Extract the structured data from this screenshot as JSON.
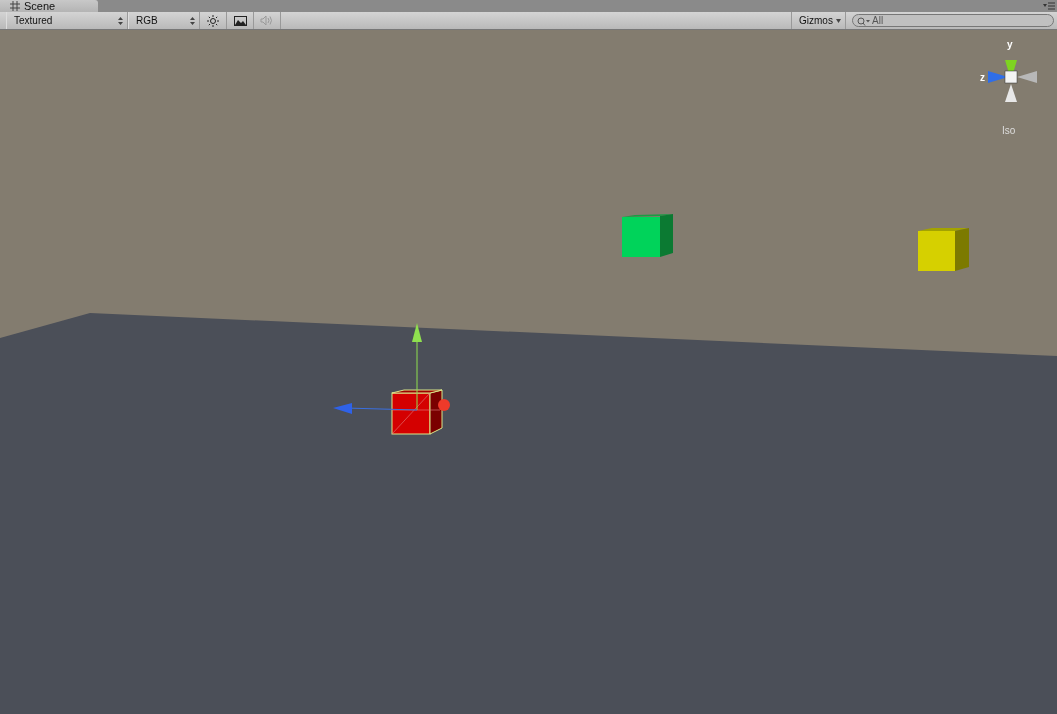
{
  "tab": {
    "label": "Scene"
  },
  "toolbar": {
    "draw_mode": "Textured",
    "render_mode": "RGB",
    "toggles": [
      {
        "kind": "lighting",
        "disabled": false
      },
      {
        "kind": "image",
        "disabled": false
      },
      {
        "kind": "audio",
        "disabled": true
      }
    ],
    "gizmos": "Gizmos",
    "search": {
      "placeholder": "All"
    }
  },
  "orientation_gizmo": {
    "y_label": "y",
    "z_label": "z",
    "projection": "Iso"
  }
}
